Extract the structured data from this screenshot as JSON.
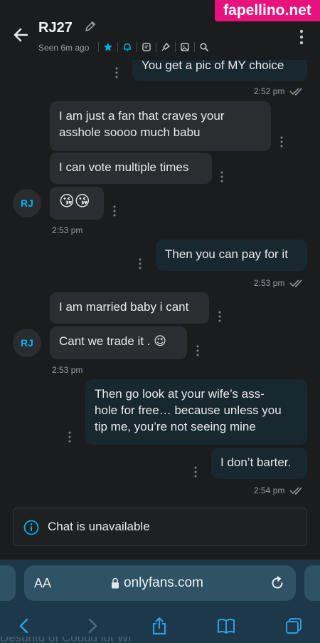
{
  "watermark": "fapellino.net",
  "header": {
    "name": "RJ27",
    "seen": "Seen 6m ago",
    "tools": [
      "star-icon",
      "bell-icon",
      "note-icon",
      "pin-icon",
      "image-icon",
      "search-icon"
    ],
    "accent": "#00aff0"
  },
  "messages": [
    {
      "text": "You get a pic of MY choice"
    },
    {
      "time": "2:52 pm"
    },
    {
      "line1": "I am just a fan that craves your",
      "line2": "asshole soooo much babu"
    },
    {
      "text": "I can vote multiple times"
    },
    {
      "emoji": "😘😘",
      "avatar": "RJ"
    },
    {
      "time": "2:53 pm"
    },
    {
      "text": "Then you can pay for it"
    },
    {
      "time": "2:53 pm"
    },
    {
      "text": "I am married baby i cant"
    },
    {
      "text": "Cant we trade it . 😉",
      "avatar": "RJ"
    },
    {
      "time": "2:53 pm"
    },
    {
      "line1": "Then go look at your wife’s ass-",
      "line2": "hole for free… because unless you",
      "line3": "tip me, you’re not seeing mine"
    },
    {
      "text": "I don’t barter."
    },
    {
      "time": "2:54 pm"
    }
  ],
  "notice": {
    "text": "Chat is unavailable"
  },
  "browser": {
    "aa": "AA",
    "url": "onlyfans.com",
    "bottom_text": "Desuntu of Coudd lot Wi"
  }
}
